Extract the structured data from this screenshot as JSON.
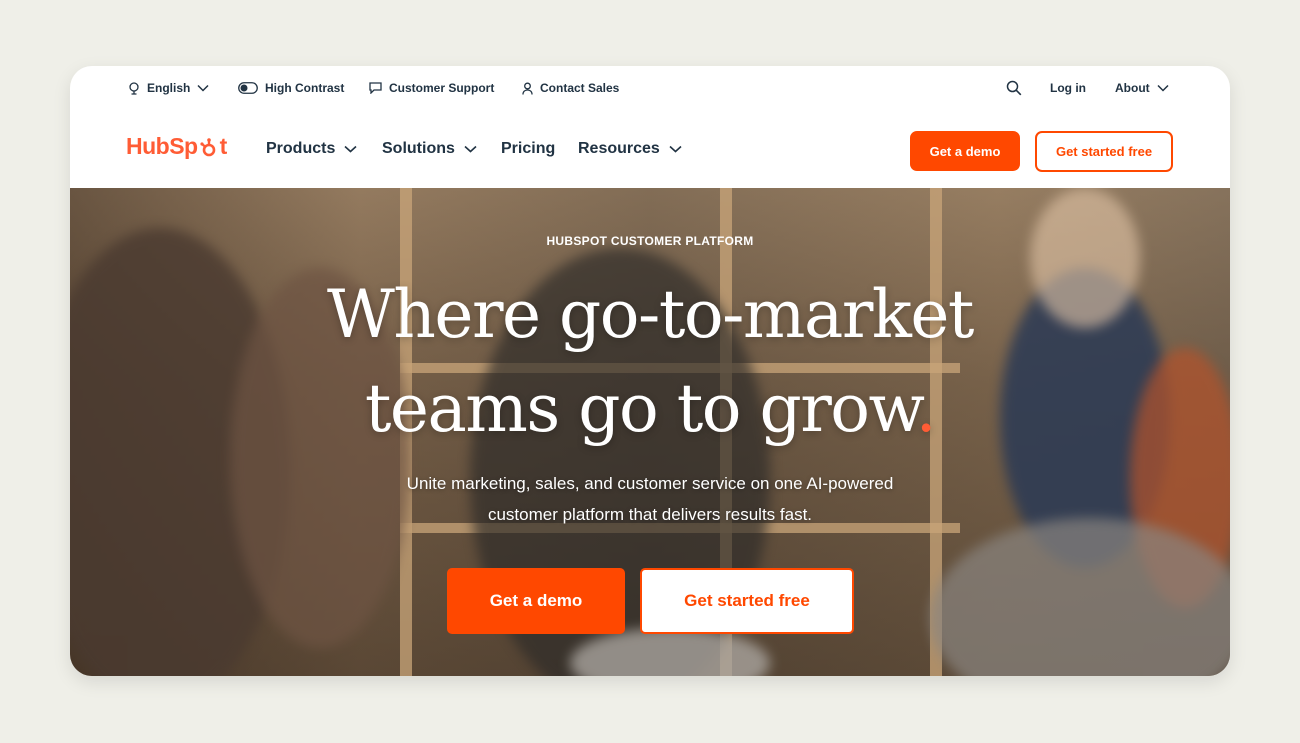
{
  "utility": {
    "language": "English",
    "high_contrast": "High Contrast",
    "customer_support": "Customer Support",
    "contact_sales": "Contact Sales",
    "login": "Log in",
    "about": "About"
  },
  "nav": {
    "logo": "HubSpot",
    "logo_left": "HubSp",
    "logo_right": "t",
    "items": [
      "Products",
      "Solutions",
      "Pricing",
      "Resources"
    ],
    "demo_button": "Get a demo",
    "free_button": "Get started free"
  },
  "hero": {
    "eyebrow": "HUBSPOT CUSTOMER PLATFORM",
    "headline_line1": "Where go-to-market",
    "headline_line2": "teams go to grow",
    "headline_dot": ".",
    "subtext_line1": "Unite marketing, sales, and customer service on one AI-powered",
    "subtext_line2": "customer platform that delivers results fast.",
    "demo_button": "Get a demo",
    "free_button": "Get started free"
  },
  "colors": {
    "brand_orange": "#ff4800",
    "text_dark": "#213343",
    "page_background": "#efefe8"
  },
  "icons": {
    "language": "globe-icon",
    "contrast": "contrast-toggle-icon",
    "support": "chat-bubble-icon",
    "sales": "person-icon",
    "search": "search-icon",
    "dropdown": "chevron-down-icon"
  }
}
